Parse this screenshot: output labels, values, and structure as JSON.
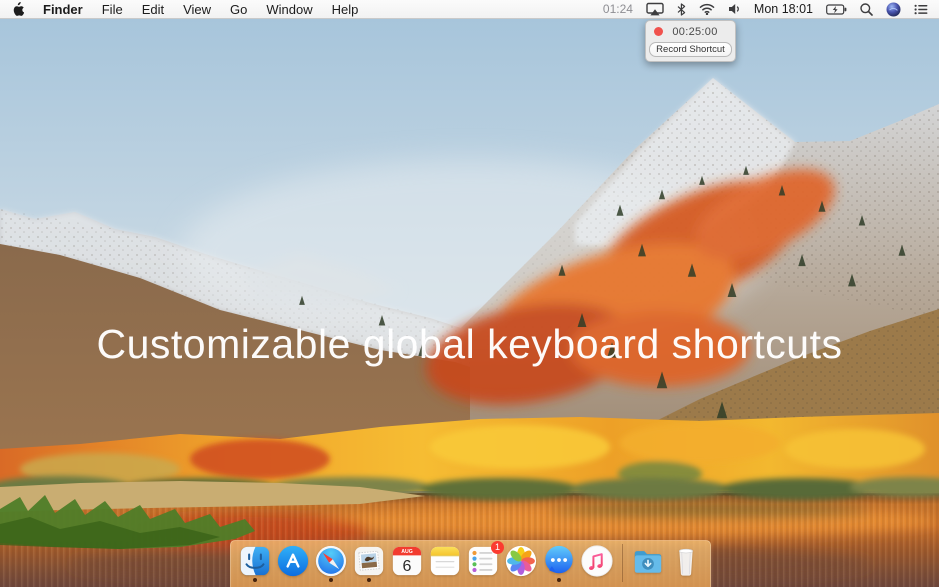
{
  "menu_bar": {
    "app_menus": [
      "Finder",
      "File",
      "Edit",
      "View",
      "Go",
      "Window",
      "Help"
    ],
    "active_app": "Finder",
    "status": {
      "timer": "01:24",
      "clock": "Mon 18:01",
      "icons": [
        "screen-mirroring",
        "bluetooth",
        "wifi",
        "volume",
        "battery-charging",
        "spotlight-search",
        "siri",
        "notification-center"
      ]
    }
  },
  "timer_popover": {
    "time": "00:25:00",
    "button_label": "Record Shortcut",
    "record_indicator_color": "#f0524d"
  },
  "desktop": {
    "hero_text": "Customizable global keyboard shortcuts"
  },
  "dock": {
    "items": [
      "finder",
      "app-store",
      "safari",
      "mail",
      "calendar",
      "notes",
      "reminders",
      "photos",
      "messages",
      "itunes",
      "divider",
      "downloads",
      "trash"
    ],
    "running": [
      "finder",
      "safari",
      "mail",
      "messages"
    ],
    "calendar": {
      "month": "AUG",
      "day": "6"
    },
    "reminders_badge": "1"
  },
  "colors": {
    "menubar_bg": "#f6f6f6",
    "record_red": "#f0524d",
    "popover_bg": "#ececec",
    "dock_tint": "#f0a95e",
    "hero_text": "#ffffff",
    "sky_top": "#a7c5db",
    "autumn_orange": "#e8742a",
    "lake_brown": "#8d5430"
  }
}
